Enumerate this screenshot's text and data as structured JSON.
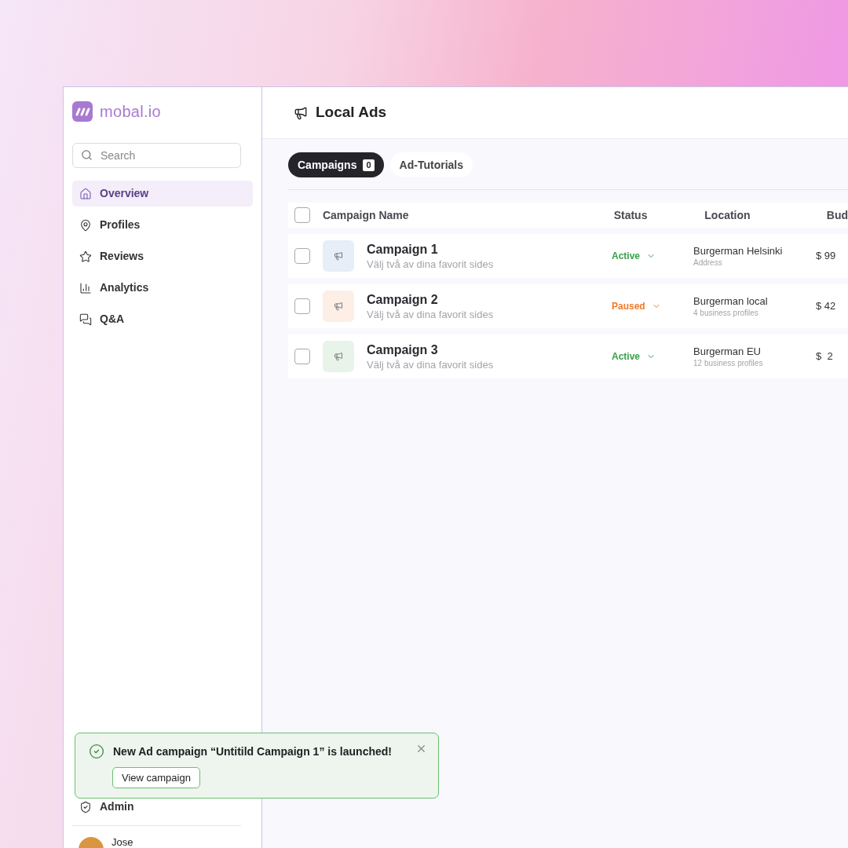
{
  "brand": {
    "name": "mobal.io"
  },
  "sidebar": {
    "search": {
      "placeholder": "Search"
    },
    "items": [
      {
        "kind": "home",
        "label": "Overview",
        "selected": true
      },
      {
        "kind": "pin",
        "label": "Profiles",
        "selected": false
      },
      {
        "kind": "star",
        "label": "Reviews",
        "selected": false
      },
      {
        "kind": "chart",
        "label": "Analytics",
        "selected": false
      },
      {
        "kind": "chat",
        "label": "Q&A",
        "selected": false
      }
    ],
    "bottom_items": [
      {
        "kind": "shield",
        "label": "Admin"
      }
    ],
    "user": {
      "name": "Jose"
    }
  },
  "header": {
    "title": "Local Ads"
  },
  "tabs": [
    {
      "label": "Campaigns",
      "count": "0",
      "selected": true
    },
    {
      "label": "Ad-Tutorials",
      "selected": false
    }
  ],
  "table": {
    "columns": [
      "Campaign Name",
      "Status",
      "Location",
      "Bud"
    ],
    "select_all_checked": false,
    "rows": [
      {
        "name": "Campaign 1",
        "subtitle": "Välj två av dina favorit sides",
        "color": "#e6eef8",
        "status": "Active",
        "kind": "active",
        "location": "Burgerman Helsinki",
        "location_sub": "Address",
        "budget": "$ 99",
        "checked": false
      },
      {
        "name": "Campaign 2",
        "subtitle": "Välj två av dina favorit sides",
        "color": "#fdeee6",
        "status": "Paused",
        "kind": "paused",
        "location": "Burgerman local",
        "location_sub": "4 business profiles",
        "budget": "$ 42",
        "checked": false
      },
      {
        "name": "Campaign 3",
        "subtitle": "Välj två av dina favorit sides",
        "color": "#e8f3ea",
        "status": "Active",
        "kind": "active",
        "location": "Burgerman EU",
        "location_sub": "12 business profiles",
        "budget": "$  2",
        "checked": false
      }
    ]
  },
  "toast": {
    "message": "New Ad campaign “Untitild Campaign 1” is launched!",
    "action": "View campaign"
  }
}
